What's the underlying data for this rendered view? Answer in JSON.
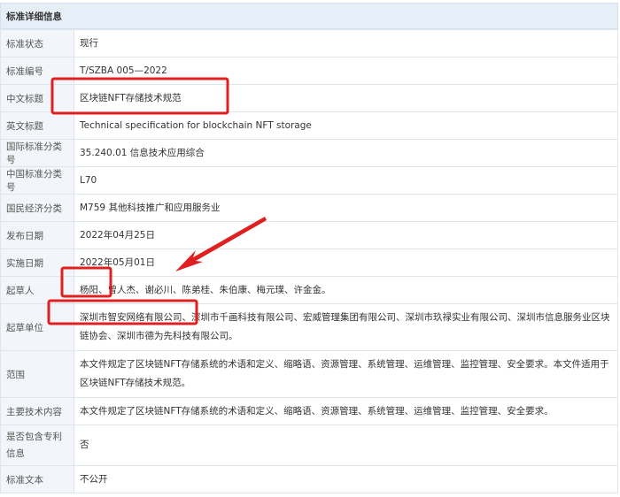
{
  "header": {
    "title": "标准详细信息"
  },
  "rows": [
    {
      "key": "标准状态",
      "value": "现行"
    },
    {
      "key": "标准编号",
      "value": "T/SZBA 005—2022"
    },
    {
      "key": "中文标题",
      "value": "区块链NFT存储技术规范"
    },
    {
      "key": "英文标题",
      "value": "Technical specification for blockchain NFT storage"
    },
    {
      "key": "国际标准分类号",
      "value": "35.240.01 信息技术应用综合"
    },
    {
      "key": "中国标准分类号",
      "value": "L70"
    },
    {
      "key": "国民经济分类",
      "value": "M759 其他科技推广和应用服务业"
    },
    {
      "key": "发布日期",
      "value": "2022年04月25日"
    },
    {
      "key": "实施日期",
      "value": "2022年05月01日"
    },
    {
      "key": "起草人",
      "value": "杨阳、曾人杰、谢必川、陈弟桂、朱伯康、梅元璞、许金金。"
    },
    {
      "key": "起草单位",
      "value": "深圳市智安网络有限公司、深圳市千画科技有限公司、宏威管理集团有限公司、深圳市玖禄实业有限公司、深圳市信息服务业区块链协会、深圳市德为先科技有限公司。"
    },
    {
      "key": "范围",
      "value": "本文件规定了区块链NFT存储系统的术语和定义、缩略语、资源管理、系统管理、运维管理、监控管理、安全要求。本文件适用于区块链NFT存储技术规范。"
    },
    {
      "key": "主要技术内容",
      "value": "本文件规定了区块链NFT存储系统的术语和定义、缩略语、资源管理、系统管理、运维管理、监控管理、安全要求。"
    },
    {
      "key": "是否包含专利信息",
      "value": "否"
    },
    {
      "key": "标准文本",
      "value": "不公开"
    }
  ],
  "annotation_color": "#e02020"
}
